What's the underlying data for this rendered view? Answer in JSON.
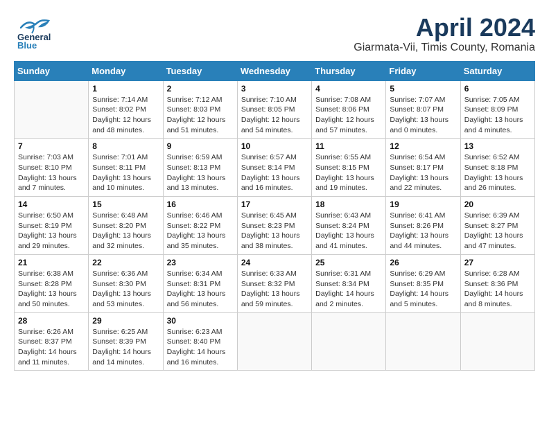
{
  "header": {
    "logo_general": "General",
    "logo_blue": "Blue",
    "title": "April 2024",
    "subtitle": "Giarmata-Vii, Timis County, Romania"
  },
  "calendar": {
    "days_of_week": [
      "Sunday",
      "Monday",
      "Tuesday",
      "Wednesday",
      "Thursday",
      "Friday",
      "Saturday"
    ],
    "weeks": [
      [
        {
          "day": "",
          "info": ""
        },
        {
          "day": "1",
          "info": "Sunrise: 7:14 AM\nSunset: 8:02 PM\nDaylight: 12 hours\nand 48 minutes."
        },
        {
          "day": "2",
          "info": "Sunrise: 7:12 AM\nSunset: 8:03 PM\nDaylight: 12 hours\nand 51 minutes."
        },
        {
          "day": "3",
          "info": "Sunrise: 7:10 AM\nSunset: 8:05 PM\nDaylight: 12 hours\nand 54 minutes."
        },
        {
          "day": "4",
          "info": "Sunrise: 7:08 AM\nSunset: 8:06 PM\nDaylight: 12 hours\nand 57 minutes."
        },
        {
          "day": "5",
          "info": "Sunrise: 7:07 AM\nSunset: 8:07 PM\nDaylight: 13 hours\nand 0 minutes."
        },
        {
          "day": "6",
          "info": "Sunrise: 7:05 AM\nSunset: 8:09 PM\nDaylight: 13 hours\nand 4 minutes."
        }
      ],
      [
        {
          "day": "7",
          "info": "Sunrise: 7:03 AM\nSunset: 8:10 PM\nDaylight: 13 hours\nand 7 minutes."
        },
        {
          "day": "8",
          "info": "Sunrise: 7:01 AM\nSunset: 8:11 PM\nDaylight: 13 hours\nand 10 minutes."
        },
        {
          "day": "9",
          "info": "Sunrise: 6:59 AM\nSunset: 8:13 PM\nDaylight: 13 hours\nand 13 minutes."
        },
        {
          "day": "10",
          "info": "Sunrise: 6:57 AM\nSunset: 8:14 PM\nDaylight: 13 hours\nand 16 minutes."
        },
        {
          "day": "11",
          "info": "Sunrise: 6:55 AM\nSunset: 8:15 PM\nDaylight: 13 hours\nand 19 minutes."
        },
        {
          "day": "12",
          "info": "Sunrise: 6:54 AM\nSunset: 8:17 PM\nDaylight: 13 hours\nand 22 minutes."
        },
        {
          "day": "13",
          "info": "Sunrise: 6:52 AM\nSunset: 8:18 PM\nDaylight: 13 hours\nand 26 minutes."
        }
      ],
      [
        {
          "day": "14",
          "info": "Sunrise: 6:50 AM\nSunset: 8:19 PM\nDaylight: 13 hours\nand 29 minutes."
        },
        {
          "day": "15",
          "info": "Sunrise: 6:48 AM\nSunset: 8:20 PM\nDaylight: 13 hours\nand 32 minutes."
        },
        {
          "day": "16",
          "info": "Sunrise: 6:46 AM\nSunset: 8:22 PM\nDaylight: 13 hours\nand 35 minutes."
        },
        {
          "day": "17",
          "info": "Sunrise: 6:45 AM\nSunset: 8:23 PM\nDaylight: 13 hours\nand 38 minutes."
        },
        {
          "day": "18",
          "info": "Sunrise: 6:43 AM\nSunset: 8:24 PM\nDaylight: 13 hours\nand 41 minutes."
        },
        {
          "day": "19",
          "info": "Sunrise: 6:41 AM\nSunset: 8:26 PM\nDaylight: 13 hours\nand 44 minutes."
        },
        {
          "day": "20",
          "info": "Sunrise: 6:39 AM\nSunset: 8:27 PM\nDaylight: 13 hours\nand 47 minutes."
        }
      ],
      [
        {
          "day": "21",
          "info": "Sunrise: 6:38 AM\nSunset: 8:28 PM\nDaylight: 13 hours\nand 50 minutes."
        },
        {
          "day": "22",
          "info": "Sunrise: 6:36 AM\nSunset: 8:30 PM\nDaylight: 13 hours\nand 53 minutes."
        },
        {
          "day": "23",
          "info": "Sunrise: 6:34 AM\nSunset: 8:31 PM\nDaylight: 13 hours\nand 56 minutes."
        },
        {
          "day": "24",
          "info": "Sunrise: 6:33 AM\nSunset: 8:32 PM\nDaylight: 13 hours\nand 59 minutes."
        },
        {
          "day": "25",
          "info": "Sunrise: 6:31 AM\nSunset: 8:34 PM\nDaylight: 14 hours\nand 2 minutes."
        },
        {
          "day": "26",
          "info": "Sunrise: 6:29 AM\nSunset: 8:35 PM\nDaylight: 14 hours\nand 5 minutes."
        },
        {
          "day": "27",
          "info": "Sunrise: 6:28 AM\nSunset: 8:36 PM\nDaylight: 14 hours\nand 8 minutes."
        }
      ],
      [
        {
          "day": "28",
          "info": "Sunrise: 6:26 AM\nSunset: 8:37 PM\nDaylight: 14 hours\nand 11 minutes."
        },
        {
          "day": "29",
          "info": "Sunrise: 6:25 AM\nSunset: 8:39 PM\nDaylight: 14 hours\nand 14 minutes."
        },
        {
          "day": "30",
          "info": "Sunrise: 6:23 AM\nSunset: 8:40 PM\nDaylight: 14 hours\nand 16 minutes."
        },
        {
          "day": "",
          "info": ""
        },
        {
          "day": "",
          "info": ""
        },
        {
          "day": "",
          "info": ""
        },
        {
          "day": "",
          "info": ""
        }
      ]
    ]
  }
}
